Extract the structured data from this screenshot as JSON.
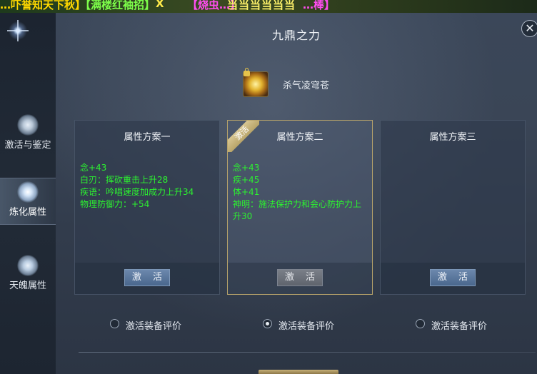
{
  "top_marquee": {
    "segments": [
      "…吓誉知天下秋】",
      "【满楼红袖招】",
      "X",
      "【烧虫…】",
      "当当当当当当",
      "…棒】"
    ]
  },
  "sidebar": {
    "items": [
      {
        "label": "激活与鉴定",
        "icon": "sword-shield-icon",
        "active": false
      },
      {
        "label": "炼化属性",
        "icon": "glowing-orb-icon",
        "active": true
      },
      {
        "label": "天魄属性",
        "icon": "moon-spirit-icon",
        "active": false
      }
    ]
  },
  "panel": {
    "title": "九鼎之力",
    "close_icon": "close-icon"
  },
  "item": {
    "name": "杀气凌穹苍",
    "icon": "item-orb-icon",
    "locked": true
  },
  "schemes": [
    {
      "title": "属性方案一",
      "attributes": [
        "念+43",
        "白刃：挥砍重击上升28",
        "疾语：吟唱速度加成力上升34",
        "物理防御力：+54"
      ],
      "button_label": "激 活",
      "radio_label": "激活装备评价",
      "selected": false
    },
    {
      "title": "属性方案二",
      "ribbon": "激活",
      "attributes": [
        "念+43",
        "疾+45",
        "体+41",
        "神明：施法保护力和会心防护力上升30"
      ],
      "button_label": "激 活",
      "radio_label": "激活装备评价",
      "selected": true
    },
    {
      "title": "属性方案三",
      "attributes": [],
      "button_label": "激 活",
      "radio_label": "激活装备评价",
      "selected": false
    }
  ],
  "colors": {
    "attribute_text": "#2cf230",
    "selected_border": "#b7a36a",
    "panel_bg": "#3a4556"
  }
}
